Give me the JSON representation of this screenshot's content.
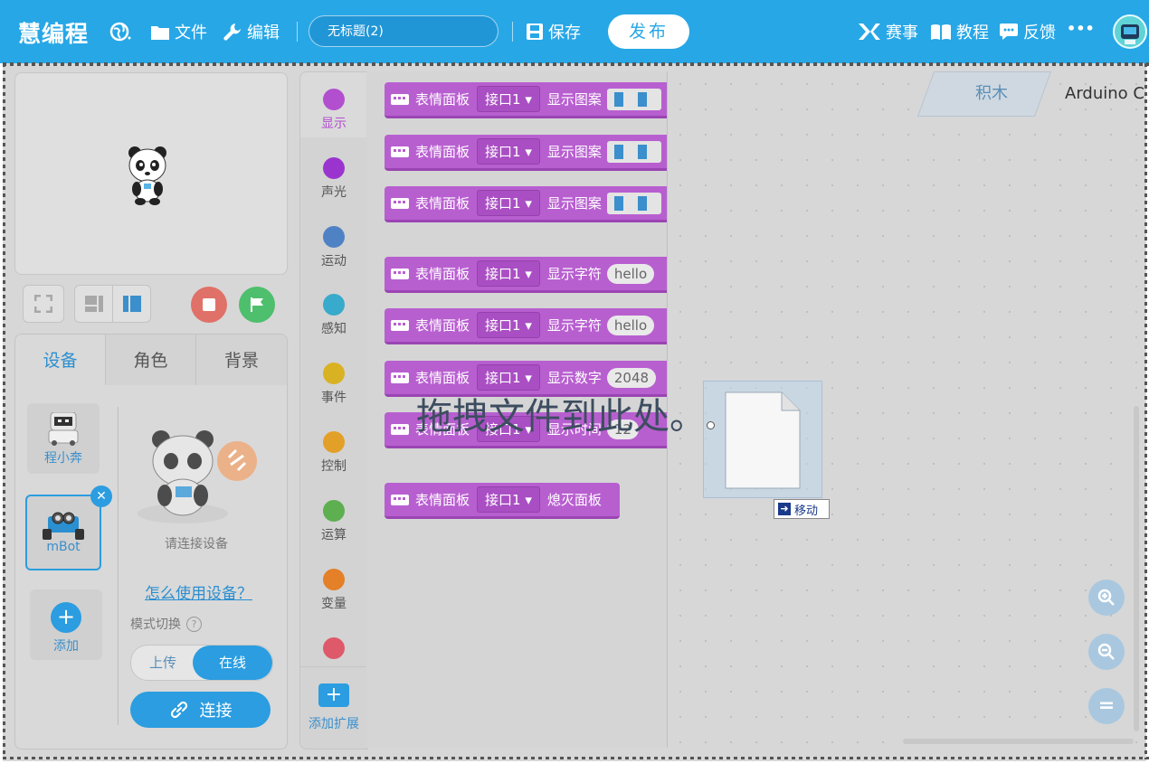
{
  "app": {
    "logo": "慧编程",
    "menu": {
      "file": "文件",
      "edit": "编辑"
    },
    "project_title": "无标题(2)",
    "save": "保存",
    "publish": "发布",
    "right_links": {
      "events": "赛事",
      "tutorials": "教程",
      "feedback": "反馈",
      "more": "•••"
    }
  },
  "sidebar": {
    "tabs": [
      "设备",
      "角色",
      "背景"
    ],
    "active_tab": "设备",
    "devices": [
      {
        "name": "程小奔"
      },
      {
        "name": "mBot",
        "selected": true
      }
    ],
    "add_label": "添加",
    "connect_hint": "请连接设备",
    "how_to_link": "怎么使用设备？",
    "mode_label": "模式切换",
    "mode_options": [
      "上传",
      "在线"
    ],
    "mode_selected": "在线",
    "connect_button": "连接"
  },
  "categories": {
    "items": [
      {
        "label": "显示",
        "color": "#b24fcf"
      },
      {
        "label": "声光",
        "color": "#9b34cf"
      },
      {
        "label": "运动",
        "color": "#4f82c4"
      },
      {
        "label": "感知",
        "color": "#38aacb"
      },
      {
        "label": "事件",
        "color": "#d9b223"
      },
      {
        "label": "控制",
        "color": "#e3a028"
      },
      {
        "label": "运算",
        "color": "#5daf50"
      },
      {
        "label": "变量",
        "color": "#e38028"
      },
      {
        "label": "",
        "color": "#de5a6a"
      }
    ],
    "active": "显示",
    "add_extension": "添加扩展"
  },
  "blocks": [
    {
      "name": "表情面板",
      "port": "接口1",
      "action": "显示图案",
      "arg": ""
    },
    {
      "name": "表情面板",
      "port": "接口1",
      "action": "显示图案",
      "arg": ""
    },
    {
      "name": "表情面板",
      "port": "接口1",
      "action": "显示图案",
      "arg": ""
    },
    {
      "name": "表情面板",
      "port": "接口1",
      "action": "显示字符",
      "arg": "hello"
    },
    {
      "name": "表情面板",
      "port": "接口1",
      "action": "显示字符",
      "arg": "hello"
    },
    {
      "name": "表情面板",
      "port": "接口1",
      "action": "显示数字",
      "arg": "2048"
    },
    {
      "name": "表情面板",
      "port": "接口1",
      "action": "显示时间",
      "arg": "12"
    },
    {
      "name": "表情面板",
      "port": "接口1",
      "action": "熄灭面板",
      "arg": ""
    }
  ],
  "editor_tabs": [
    "积木",
    "Arduino C"
  ],
  "drag_overlay": {
    "text": "拖拽文件到此处。",
    "move_tip": "移动"
  },
  "zoom": {
    "zoom_in": "+",
    "zoom_out": "−",
    "reset": "="
  }
}
